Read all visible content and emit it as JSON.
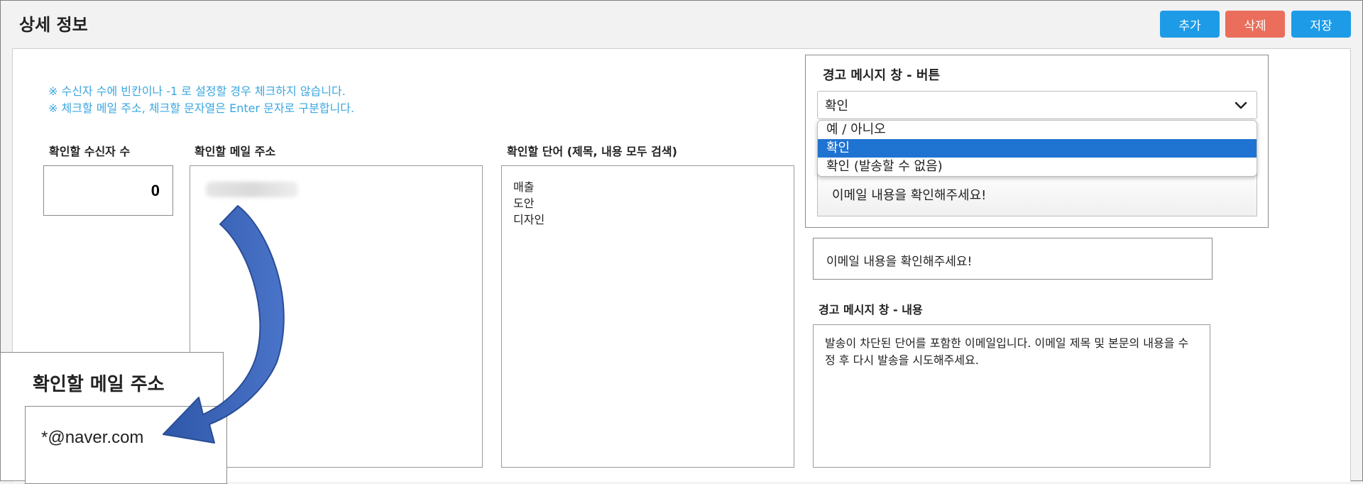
{
  "header": {
    "title": "상세 정보",
    "buttons": {
      "add": "추가",
      "delete": "삭제",
      "save": "저장"
    }
  },
  "notices": [
    "※ 수신자 수에 빈칸이나 -1 로 설정할 경우 체크하지 않습니다.",
    "※ 체크할 메일 주소, 체크할 문자열은 Enter 문자로 구분합니다."
  ],
  "recipient_count": {
    "label": "확인할 수신자 수",
    "value": "0"
  },
  "email": {
    "label": "확인할 메일 주소"
  },
  "words": {
    "label": "확인할 단어 (제목, 내용 모두 검색)",
    "items": [
      "매출",
      "도안",
      "디자인"
    ]
  },
  "alert_button": {
    "title": "경고 메시지 창 - 버튼",
    "selected": "확인",
    "options": [
      "예 / 아니오",
      "확인",
      "확인 (발송할 수 없음)"
    ],
    "preview_text": "이메일 내용을 확인해주세요!"
  },
  "message_box": {
    "text": "이메일 내용을 확인해주세요!"
  },
  "alert_content": {
    "title": "경고 메시지 창 - 내용",
    "text": "발송이 차단된 단어를 포함한 이메일입니다. 이메일 제목 및 본문의 내용을 수정 후 다시 발송을 시도해주세요."
  },
  "zoom_callout": {
    "label": "확인할 메일 주소",
    "value": "*@naver.com"
  },
  "colors": {
    "accent_blue": "#1e9be6",
    "delete_red": "#ea6e5b",
    "notice_blue": "#3aa6e0",
    "arrow_blue": "#3a63b8",
    "selected_option": "#1f73d1"
  }
}
